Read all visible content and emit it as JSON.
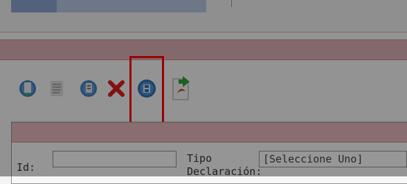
{
  "toolbar": {
    "icons": [
      {
        "name": "new-record-icon"
      },
      {
        "name": "list-icon"
      },
      {
        "name": "edit-record-icon"
      },
      {
        "name": "delete-icon"
      },
      {
        "name": "save-icon"
      },
      {
        "name": "export-pdf-icon"
      }
    ],
    "highlight_color": "#ff0000"
  },
  "form": {
    "id_label": "Id:",
    "id_value": "",
    "tipo_label_line1": "Tipo",
    "tipo_label_line2": "Declaración:",
    "tipo_select_value": "[Seleccione Uno]"
  },
  "colors": {
    "header_bar": "#ddb0b4",
    "accent_tab": "#b7c7e3"
  }
}
